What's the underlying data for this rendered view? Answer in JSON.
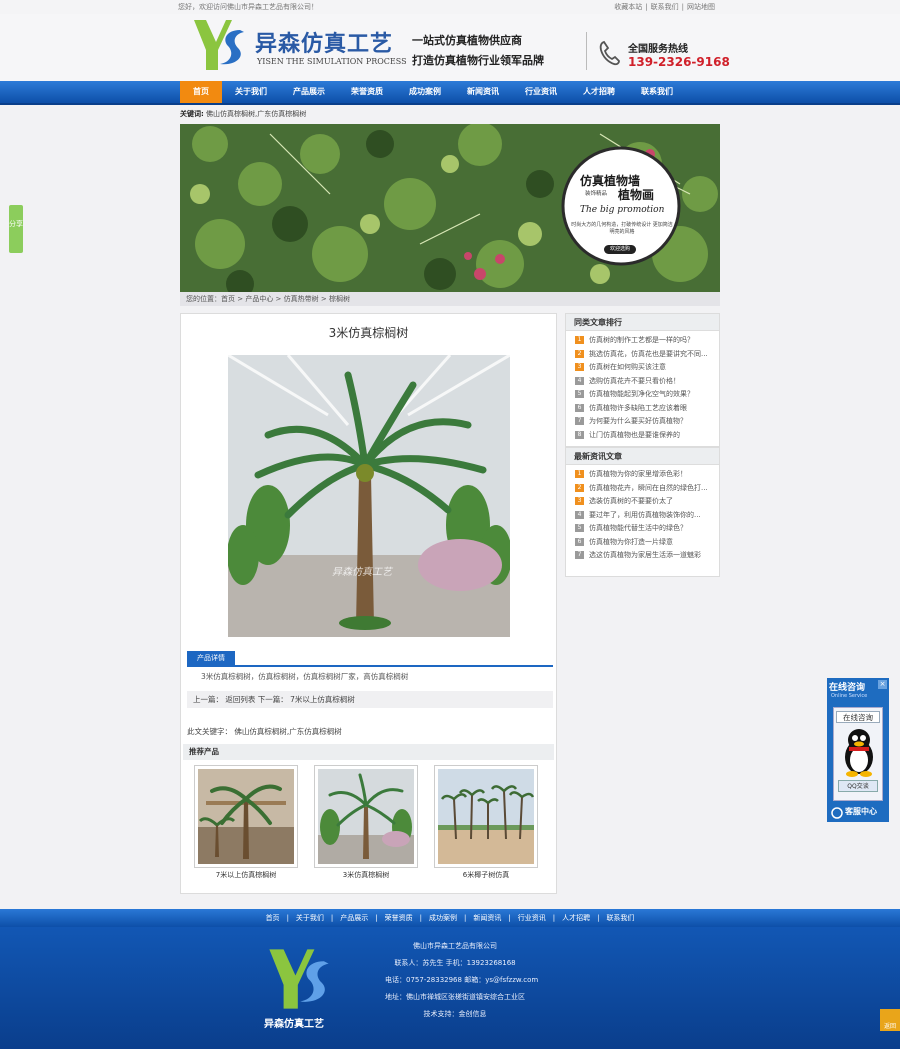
{
  "topbar": {
    "welcome": "您好，欢迎访问佛山市异森工艺品有限公司！",
    "links": [
      "收藏本站",
      "联系我们",
      "网站地图"
    ]
  },
  "header": {
    "logo_name": "异森仿真工艺",
    "logo_en": "YISEN THE SIMULATION PROCESS",
    "slogan1": "一站式仿真植物供应商",
    "slogan2": "打造仿真植物行业领军品牌",
    "hotline_label": "全国服务热线",
    "hotline": "139-2326-9168"
  },
  "nav": [
    "首页",
    "关于我们",
    "产品展示",
    "荣誉资质",
    "成功案例",
    "新闻资讯",
    "行业资讯",
    "人才招聘",
    "联系我们"
  ],
  "keywords_bar": {
    "label": "关键词:",
    "value": "佛山仿真棕榈树,广东仿真棕榈树"
  },
  "banner": {
    "title1": "仿真植物墙",
    "badge": "装饰精品",
    "title2": "植物画",
    "promo": "The big promotion",
    "desc": "时尚大方的几何构造，打破传统设计  更加简洁明亮的风格",
    "button": "欢迎选购"
  },
  "breadcrumb": "您的位置：首页 > 产品中心 > 仿真热带树 > 棕榈树",
  "product": {
    "title": "3米仿真棕榈树",
    "watermark": "异森仿真工艺",
    "detail_tab": "产品详情",
    "detail_text": "3米仿真棕榈树，仿真棕榈树，仿真棕榈树厂家，高仿真棕榈树",
    "prevnext": "上一篇：  返回列表   下一篇：  7米以上仿真棕榈树",
    "keywords": "此文关键字：  佛山仿真棕榈树,广东仿真棕榈树"
  },
  "recommend": {
    "title": "推荐产品",
    "items": [
      "7米以上仿真棕榈树",
      "3米仿真棕榈树",
      "6米椰子树仿真"
    ]
  },
  "sidebar": {
    "hot_title": "同类文章排行",
    "hot": [
      "仿真树的制作工艺都是一样的吗？",
      "挑选仿真花，仿真花也是要讲究不同...",
      "仿真树在如何购买该注意",
      "选购仿真花卉不要只看价格！",
      "仿真植物能起到净化空气的效果？",
      "仿真植物许多缺陷工艺应该着眼",
      "为何要为什么要买好仿真植物？",
      "让门仿真植物也是要谁保养的"
    ],
    "news_title": "最新资讯文章",
    "news": [
      "仿真植物为你的家里增添色彩！",
      "仿真植物花卉，瞬间在自然的绿色打...",
      "选装仿真树的不要要价太了",
      "要过年了，利用仿真植物装饰你的...",
      "仿真植物能代替生活中的绿色？",
      "仿真植物为你打造一片绿意",
      "选这仿真植物为家居生活添一道魅彩"
    ],
    "num_colors": [
      "#f0901e",
      "#f0901e",
      "#f0901e",
      "#9a9a9a",
      "#9a9a9a",
      "#9a9a9a",
      "#9a9a9a",
      "#9a9a9a"
    ]
  },
  "footer": {
    "nav": [
      "首页",
      "关于我们",
      "产品展示",
      "荣誉资质",
      "成功案例",
      "新闻资讯",
      "行业资讯",
      "人才招聘",
      "联系我们"
    ],
    "logo_name": "异森仿真工艺",
    "lines": [
      "佛山市异森工艺品有限公司",
      "联系人：苏先生 手机：13923268168",
      "电话：0757-28332968 邮箱：ys@fsfzzw.com",
      "地址：佛山市禅城区张槎街道镇安综合工业区",
      "技术支持：金创信息"
    ]
  },
  "widgets": {
    "left_tab": "分享",
    "qq_title": "在线咨询",
    "qq_sub": "Online Service",
    "qq_online": "在线咨询",
    "qq_button": "QQ交谈",
    "qq_foot": "客服中心",
    "backtop": "返回"
  },
  "colors": {
    "nav_blue": "#1d67c2",
    "nav_active": "#f28a10",
    "hotline_red": "#d0202a",
    "brand_blue": "#2a5aa5"
  }
}
